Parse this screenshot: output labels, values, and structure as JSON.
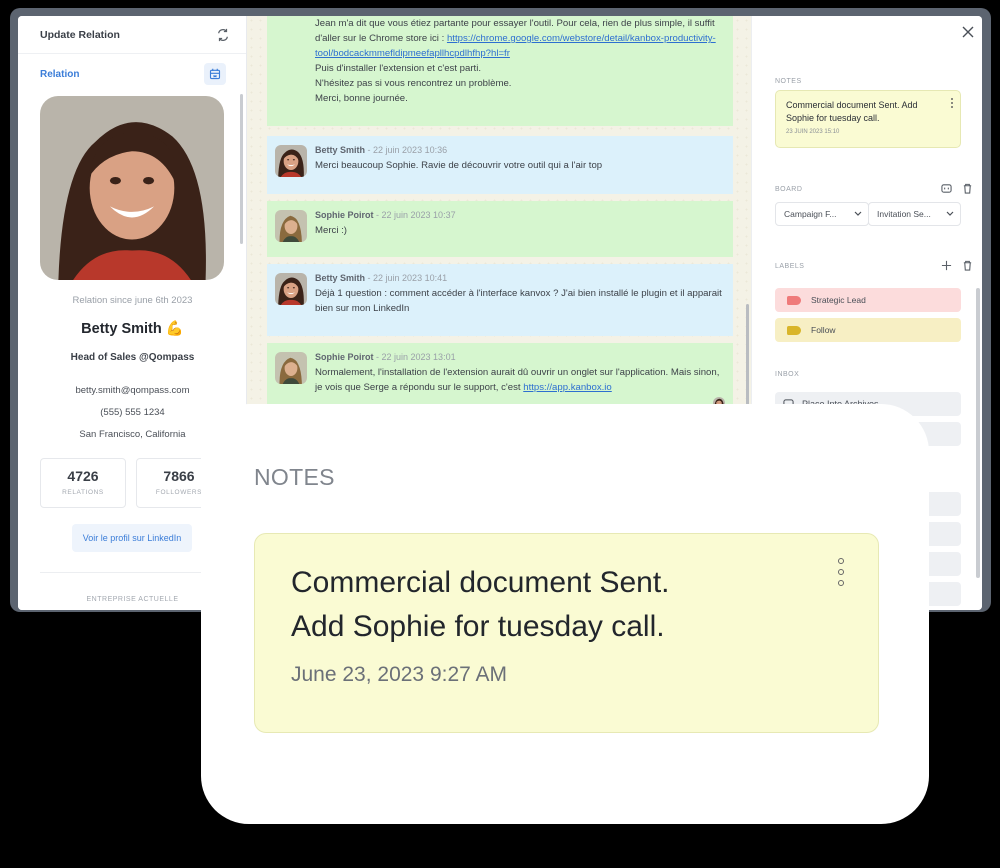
{
  "left_panel": {
    "header_title": "Update Relation",
    "section_label": "Relation",
    "relation_since": "Relation since june 6th 2023",
    "name": "Betty Smith 💪",
    "role": "Head of Sales @Qompass",
    "email": "betty.smith@qompass.com",
    "phone": "(555) 555 1234",
    "location": "San Francisco, California",
    "stats": [
      {
        "value": "4726",
        "label": "RELATIONS"
      },
      {
        "value": "7866",
        "label": "FOLLOWERS"
      }
    ],
    "linkedin_button": "Voir le profil sur LinkedIn",
    "company_section": "ENTREPRISE ACTUELLE"
  },
  "chat": {
    "top_message": {
      "lines": [
        "Jean m'a dit que vous étiez partante pour essayer l'outil. Pour cela, rien de plus simple, il suffit d'aller sur le Chrome store ici :",
        "Puis d'installer l'extension et c'est parti.",
        "N'hésitez pas si vous rencontrez un problème.",
        "Merci, bonne journée."
      ],
      "link": "https://chrome.google.com/webstore/detail/kanbox-productivity-tool/bodcackmmefldipmeefapllhcpdlhfhp?hl=fr"
    },
    "messages": [
      {
        "author": "Betty Smith",
        "time": "- 22 juin 2023 10:36",
        "text": "Merci beaucoup Sophie. Ravie de découvrir votre outil qui a l'air top"
      },
      {
        "author": "Sophie Poirot",
        "time": "- 22 juin 2023 10:37",
        "text": "Merci :)"
      },
      {
        "author": "Betty Smith",
        "time": "- 22 juin 2023 10:41",
        "text": "Déjà 1 question : comment accéder à l'interface kanvox ? J'ai bien installé le plugin et il apparait bien sur mon LinkedIn"
      },
      {
        "author": "Sophie Poirot",
        "time": "- 22 juin 2023 13:01",
        "text": "Normalement, l'installation de l'extension aurait dû ouvrir un onglet sur l'application. Mais sinon, je vois que Serge a répondu sur le support, c'est",
        "link": "https://app.kanbox.io"
      }
    ]
  },
  "right_panel": {
    "notes_title": "NOTES",
    "note_text": "Commercial document Sent. Add Sophie for tuesday call.",
    "note_date": "23 JUIN 2023 15:10",
    "board_title": "BOARD",
    "board_selects": [
      "Campaign F...",
      "Invitation Se..."
    ],
    "labels_title": "LABELS",
    "labels": [
      {
        "name": "Strategic Lead",
        "bg": "#fcdcdc",
        "tag": "#ef7a7a"
      },
      {
        "name": "Follow",
        "bg": "#f7efc4",
        "tag": "#d9b52a"
      }
    ],
    "inbox_title": "INBOX",
    "inbox_action": "Place Into Archives"
  },
  "notes_overlay": {
    "title": "NOTES",
    "text_line1": "Commercial document Sent.",
    "text_line2": "Add Sophie for tuesday call.",
    "date": "June 23, 2023 9:27 AM"
  }
}
